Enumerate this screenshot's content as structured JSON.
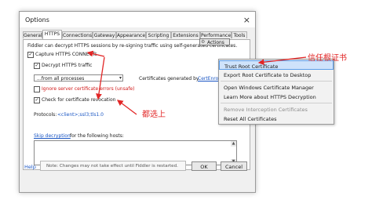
{
  "window": {
    "title": "Options",
    "close": "×"
  },
  "tabs": [
    "General",
    "HTTPS",
    "Connections",
    "Gateway",
    "Appearance",
    "Scripting",
    "Extensions",
    "Performance",
    "Tools"
  ],
  "description": "Fiddler can decrypt HTTPS sessions by re-signing traffic using self-generated certificates.",
  "options": {
    "capture_connects": "Capture HTTPS CONNECTs",
    "decrypt_traffic": "Decrypt HTTPS traffic",
    "process_select": "...from all processes",
    "ignore_errors": "Ignore server certificate errors (unsafe)",
    "check_revocation": "Check for certificate revocation"
  },
  "cert_generated_by": {
    "label": "Certificates generated by",
    "link": "CertEnroll engine"
  },
  "actions_button": "Actions",
  "protocols": {
    "label": "Protocols:",
    "value": "<client>;ssl3;tls1.0"
  },
  "skip_decryption": {
    "link": "Skip decryption",
    "rest": "for the following hosts:"
  },
  "footer": {
    "help": "Help",
    "note": "Note: Changes may not take effect until Fiddler is restarted.",
    "ok": "OK",
    "cancel": "Cancel"
  },
  "menu": {
    "trust": "Trust Root Certificate",
    "export": "Export Root Certificate to Desktop",
    "open_manager": "Open Windows Certificate Manager",
    "learn_more": "Learn More about HTTPS Decryption",
    "remove": "Remove Interception Certificates",
    "reset": "Reset All Certificates"
  },
  "annotations": {
    "trust": "信任根证书",
    "check_all": "都选上"
  },
  "colors": {
    "annotation": "#e22626",
    "link": "#1a56c4",
    "menu_highlight": "#cfe3fb"
  }
}
